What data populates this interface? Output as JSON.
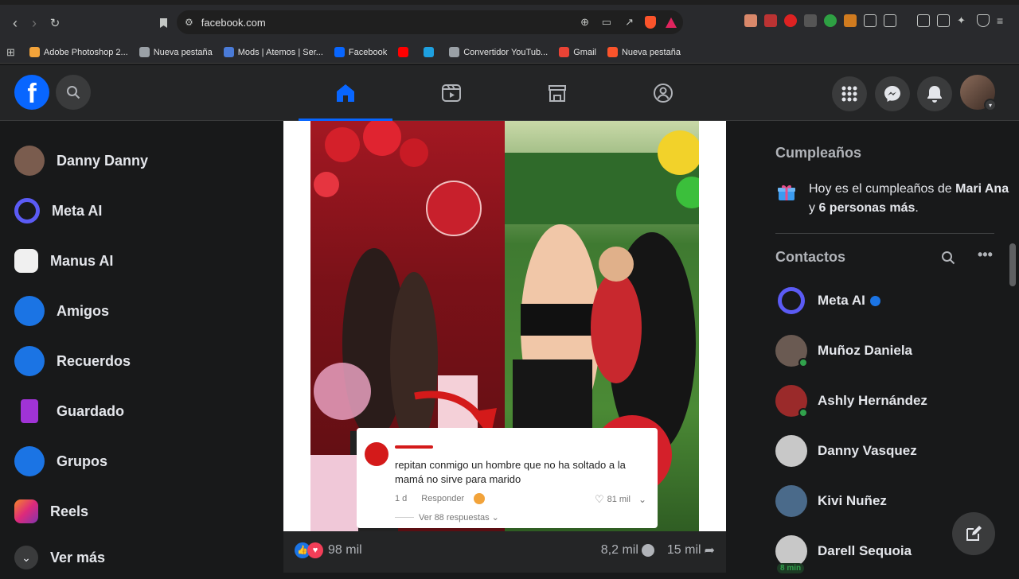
{
  "browser": {
    "url": "facebook.com",
    "bookmarks": [
      {
        "label": "Adobe Photoshop 2...",
        "icon": "photoshop-icon",
        "color": "#f2a33a"
      },
      {
        "label": "Nueva pestaña",
        "icon": "globe-icon",
        "color": "#9aa0a6"
      },
      {
        "label": "Mods | Atemos | Ser...",
        "icon": "mods-icon",
        "color": "#4a7bd8"
      },
      {
        "label": "Facebook",
        "icon": "facebook-icon",
        "color": "#0866ff"
      },
      {
        "label": "",
        "icon": "youtube-icon",
        "color": "#ff0000"
      },
      {
        "label": "",
        "icon": "l-icon",
        "color": "#1ea0e0"
      },
      {
        "label": "Convertidor YouTub...",
        "icon": "globe-icon",
        "color": "#9aa0a6"
      },
      {
        "label": "Gmail",
        "icon": "gmail-icon",
        "color": "#ea4335"
      },
      {
        "label": "Nueva pestaña",
        "icon": "brave-icon",
        "color": "#fb542b"
      }
    ]
  },
  "left_nav": [
    {
      "label": "Danny Danny",
      "icon": "profile-avatar",
      "color": "#7a5c4e"
    },
    {
      "label": "Meta AI",
      "icon": "meta-ai-icon",
      "color": "#5b5bf5"
    },
    {
      "label": "Manus AI",
      "icon": "manus-ai-icon",
      "color": "#f0f0f0"
    },
    {
      "label": "Amigos",
      "icon": "friends-icon",
      "color": "#1b74e4"
    },
    {
      "label": "Recuerdos",
      "icon": "memories-icon",
      "color": "#1b74e4"
    },
    {
      "label": "Guardado",
      "icon": "saved-icon",
      "color": "#a033d6"
    },
    {
      "label": "Grupos",
      "icon": "groups-icon",
      "color": "#1b74e4"
    },
    {
      "label": "Reels",
      "icon": "reels-icon",
      "color": "#e4405f"
    },
    {
      "label": "Ver más",
      "icon": "chevron-down-icon",
      "color": "#3a3b3c"
    }
  ],
  "post": {
    "comment_text": "repitan conmigo un hombre que no ha soltado a la mamá no sirve para marido",
    "comment_age": "1 d",
    "comment_reply": "Responder",
    "comment_likes": "81 mil",
    "comment_replies": "Ver 88 respuestas",
    "reactions": "98 mil",
    "comments": "8,2 mil",
    "shares": "15 mil"
  },
  "right": {
    "birthdays_title": "Cumpleaños",
    "birthday_text_1": "Hoy es el cumpleaños de ",
    "birthday_bold_1": "Mari Ana",
    "birthday_text_2": " y ",
    "birthday_bold_2": "6 personas más",
    "birthday_text_3": ".",
    "contacts_title": "Contactos",
    "contacts": [
      {
        "name": "Meta AI",
        "color": "#5b5bf5",
        "online": false,
        "verified": true
      },
      {
        "name": "Muñoz Daniela",
        "color": "#6a5a52",
        "online": true,
        "verified": false
      },
      {
        "name": "Ashly Hernández",
        "color": "#9a2a2a",
        "online": true,
        "verified": false
      },
      {
        "name": "Danny Vasquez",
        "color": "#c8c8c8",
        "online": false,
        "verified": false
      },
      {
        "name": "Kivi Nuñez",
        "color": "#4a6a8a",
        "online": false,
        "verified": false
      },
      {
        "name": "Darell Sequoia",
        "color": "#c8c8c8",
        "online": false,
        "verified": false
      }
    ],
    "last_seen": "8 min"
  }
}
